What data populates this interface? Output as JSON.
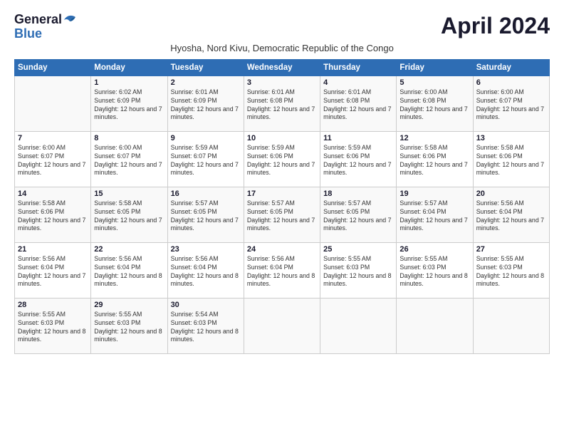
{
  "logo": {
    "line1": "General",
    "line2": "Blue"
  },
  "title": "April 2024",
  "subtitle": "Hyosha, Nord Kivu, Democratic Republic of the Congo",
  "days_of_week": [
    "Sunday",
    "Monday",
    "Tuesday",
    "Wednesday",
    "Thursday",
    "Friday",
    "Saturday"
  ],
  "weeks": [
    [
      {
        "day": "",
        "info": ""
      },
      {
        "day": "1",
        "info": "Sunrise: 6:02 AM\nSunset: 6:09 PM\nDaylight: 12 hours\nand 7 minutes."
      },
      {
        "day": "2",
        "info": "Sunrise: 6:01 AM\nSunset: 6:09 PM\nDaylight: 12 hours\nand 7 minutes."
      },
      {
        "day": "3",
        "info": "Sunrise: 6:01 AM\nSunset: 6:08 PM\nDaylight: 12 hours\nand 7 minutes."
      },
      {
        "day": "4",
        "info": "Sunrise: 6:01 AM\nSunset: 6:08 PM\nDaylight: 12 hours\nand 7 minutes."
      },
      {
        "day": "5",
        "info": "Sunrise: 6:00 AM\nSunset: 6:08 PM\nDaylight: 12 hours\nand 7 minutes."
      },
      {
        "day": "6",
        "info": "Sunrise: 6:00 AM\nSunset: 6:07 PM\nDaylight: 12 hours\nand 7 minutes."
      }
    ],
    [
      {
        "day": "7",
        "info": "Sunrise: 6:00 AM\nSunset: 6:07 PM\nDaylight: 12 hours\nand 7 minutes."
      },
      {
        "day": "8",
        "info": "Sunrise: 6:00 AM\nSunset: 6:07 PM\nDaylight: 12 hours\nand 7 minutes."
      },
      {
        "day": "9",
        "info": "Sunrise: 5:59 AM\nSunset: 6:07 PM\nDaylight: 12 hours\nand 7 minutes."
      },
      {
        "day": "10",
        "info": "Sunrise: 5:59 AM\nSunset: 6:06 PM\nDaylight: 12 hours\nand 7 minutes."
      },
      {
        "day": "11",
        "info": "Sunrise: 5:59 AM\nSunset: 6:06 PM\nDaylight: 12 hours\nand 7 minutes."
      },
      {
        "day": "12",
        "info": "Sunrise: 5:58 AM\nSunset: 6:06 PM\nDaylight: 12 hours\nand 7 minutes."
      },
      {
        "day": "13",
        "info": "Sunrise: 5:58 AM\nSunset: 6:06 PM\nDaylight: 12 hours\nand 7 minutes."
      }
    ],
    [
      {
        "day": "14",
        "info": "Sunrise: 5:58 AM\nSunset: 6:06 PM\nDaylight: 12 hours\nand 7 minutes."
      },
      {
        "day": "15",
        "info": "Sunrise: 5:58 AM\nSunset: 6:05 PM\nDaylight: 12 hours\nand 7 minutes."
      },
      {
        "day": "16",
        "info": "Sunrise: 5:57 AM\nSunset: 6:05 PM\nDaylight: 12 hours\nand 7 minutes."
      },
      {
        "day": "17",
        "info": "Sunrise: 5:57 AM\nSunset: 6:05 PM\nDaylight: 12 hours\nand 7 minutes."
      },
      {
        "day": "18",
        "info": "Sunrise: 5:57 AM\nSunset: 6:05 PM\nDaylight: 12 hours\nand 7 minutes."
      },
      {
        "day": "19",
        "info": "Sunrise: 5:57 AM\nSunset: 6:04 PM\nDaylight: 12 hours\nand 7 minutes."
      },
      {
        "day": "20",
        "info": "Sunrise: 5:56 AM\nSunset: 6:04 PM\nDaylight: 12 hours\nand 7 minutes."
      }
    ],
    [
      {
        "day": "21",
        "info": "Sunrise: 5:56 AM\nSunset: 6:04 PM\nDaylight: 12 hours\nand 7 minutes."
      },
      {
        "day": "22",
        "info": "Sunrise: 5:56 AM\nSunset: 6:04 PM\nDaylight: 12 hours\nand 8 minutes."
      },
      {
        "day": "23",
        "info": "Sunrise: 5:56 AM\nSunset: 6:04 PM\nDaylight: 12 hours\nand 8 minutes."
      },
      {
        "day": "24",
        "info": "Sunrise: 5:56 AM\nSunset: 6:04 PM\nDaylight: 12 hours\nand 8 minutes."
      },
      {
        "day": "25",
        "info": "Sunrise: 5:55 AM\nSunset: 6:03 PM\nDaylight: 12 hours\nand 8 minutes."
      },
      {
        "day": "26",
        "info": "Sunrise: 5:55 AM\nSunset: 6:03 PM\nDaylight: 12 hours\nand 8 minutes."
      },
      {
        "day": "27",
        "info": "Sunrise: 5:55 AM\nSunset: 6:03 PM\nDaylight: 12 hours\nand 8 minutes."
      }
    ],
    [
      {
        "day": "28",
        "info": "Sunrise: 5:55 AM\nSunset: 6:03 PM\nDaylight: 12 hours\nand 8 minutes."
      },
      {
        "day": "29",
        "info": "Sunrise: 5:55 AM\nSunset: 6:03 PM\nDaylight: 12 hours\nand 8 minutes."
      },
      {
        "day": "30",
        "info": "Sunrise: 5:54 AM\nSunset: 6:03 PM\nDaylight: 12 hours\nand 8 minutes."
      },
      {
        "day": "",
        "info": ""
      },
      {
        "day": "",
        "info": ""
      },
      {
        "day": "",
        "info": ""
      },
      {
        "day": "",
        "info": ""
      }
    ]
  ]
}
